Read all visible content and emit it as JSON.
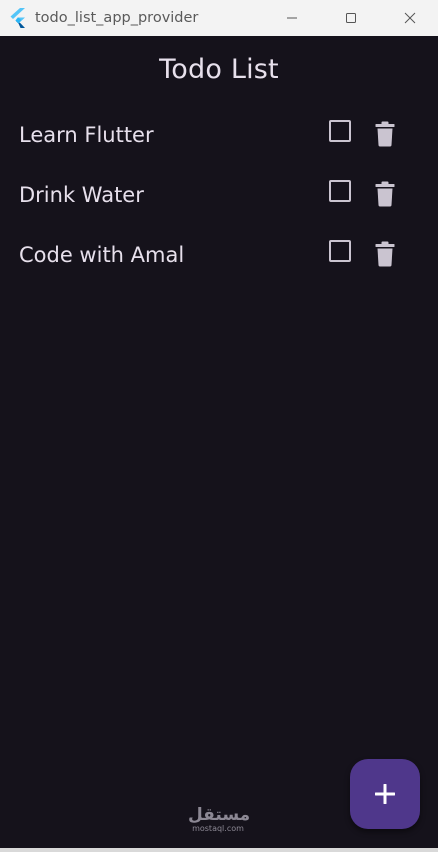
{
  "window": {
    "title": "todo_list_app_provider"
  },
  "appbar": {
    "title": "Todo List"
  },
  "todos": [
    {
      "text": "Learn Flutter",
      "done": false
    },
    {
      "text": "Drink Water",
      "done": false
    },
    {
      "text": "Code with Amal",
      "done": false
    }
  ],
  "fab": {
    "icon": "plus-icon"
  },
  "watermark": {
    "arabic": "مستقل",
    "latin": "mostaql.com"
  },
  "colors": {
    "background": "#15121b",
    "text": "#e7e0ec",
    "fab": "#4f378b",
    "icon": "#cac4d0"
  }
}
